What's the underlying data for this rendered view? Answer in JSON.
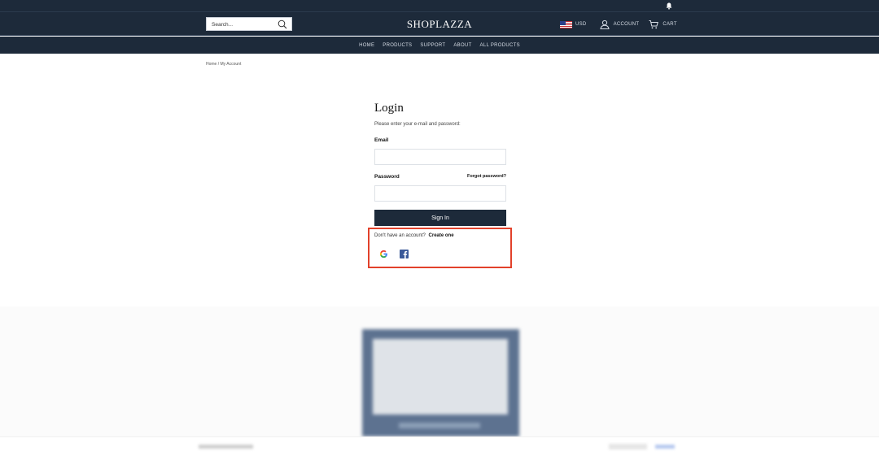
{
  "header": {
    "search_placeholder": "Search...",
    "logo": "SHOPLAZZA",
    "currency": "USD",
    "account_label": "ACCOUNT",
    "cart_label": "CART"
  },
  "nav": {
    "items": [
      "HOME",
      "PRODUCTS",
      "SUPPORT",
      "ABOUT",
      "ALL PRODUCTS"
    ]
  },
  "breadcrumb": "Home / My Account",
  "login": {
    "title": "Login",
    "subtitle": "Please enter your e-mail and password:",
    "email_label": "Email",
    "password_label": "Password",
    "forgot_label": "Forgot password?",
    "signin_label": "Sign In",
    "no_account_text": "Don't have an account?",
    "create_label": "Create one"
  },
  "colors": {
    "header_bg": "#1d2a3a",
    "highlight": "#e2412b"
  },
  "icons": [
    "bell-icon",
    "search-icon",
    "us-flag-icon",
    "account-icon",
    "cart-icon",
    "google-icon",
    "facebook-icon"
  ]
}
